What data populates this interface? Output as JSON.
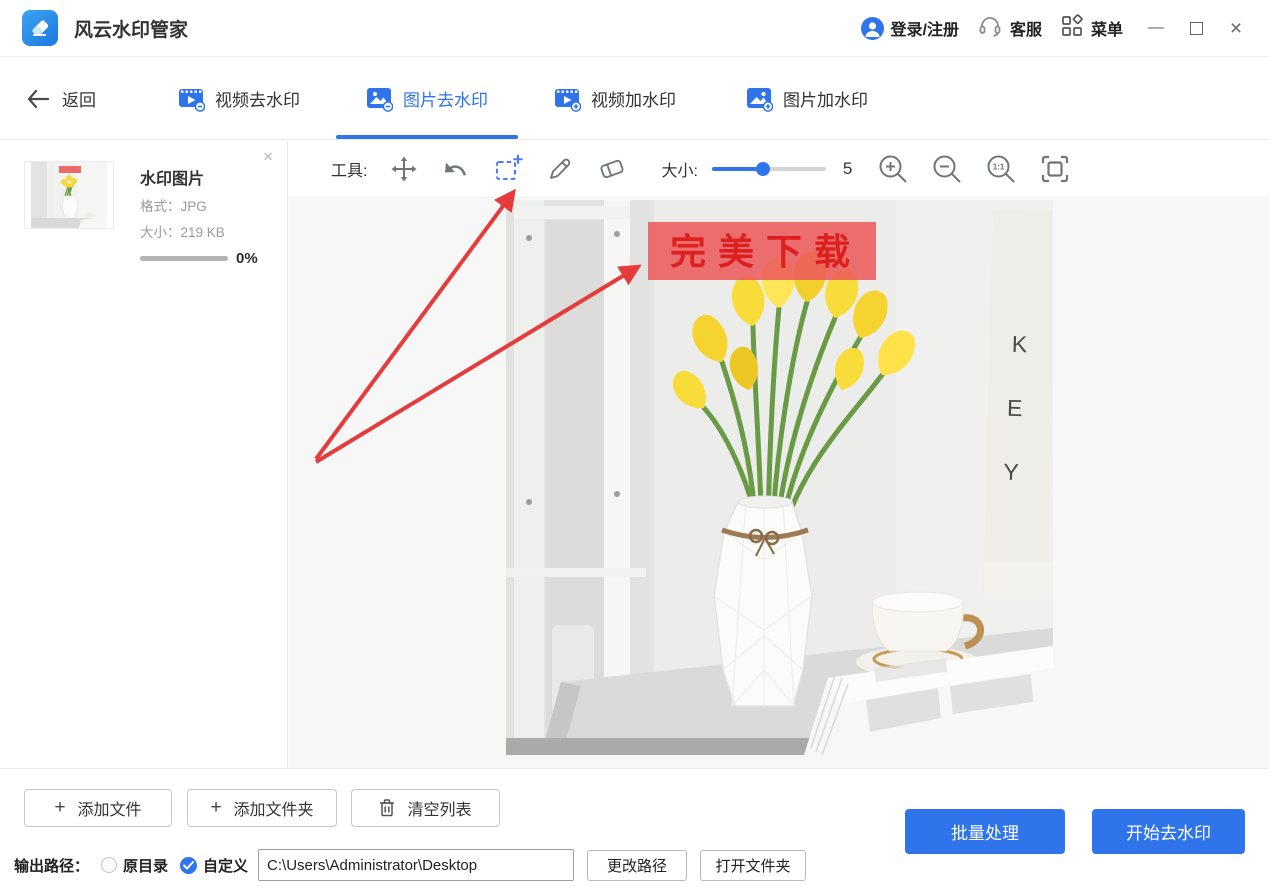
{
  "app": {
    "title": "风云水印管家"
  },
  "titlebar": {
    "login_label": "登录/注册",
    "service_label": "客服",
    "menu_label": "菜单",
    "minimize_glyph": "—",
    "close_glyph": "×"
  },
  "nav": {
    "back_label": "返回",
    "tabs": [
      {
        "label": "视频去水印"
      },
      {
        "label": "图片去水印"
      },
      {
        "label": "视频加水印"
      },
      {
        "label": "图片加水印"
      }
    ],
    "active_tab": "图片去水印"
  },
  "sidebar": {
    "file": {
      "name": "水印图片",
      "format_label": "格式：",
      "format_value": "JPG",
      "size_label": "大小：",
      "size_value": "219 KB",
      "progress_text": "0%",
      "remove_glyph": "×"
    }
  },
  "toolbar": {
    "tools_label": "工具:",
    "size_label": "大小:",
    "size_value": "5",
    "ratio_label": "1:1"
  },
  "canvas": {
    "watermark_text": "完美下载",
    "poster_letters": {
      "k": "K",
      "e": "E",
      "y": "Y"
    }
  },
  "footer": {
    "plus_glyph": "+",
    "add_file_label": "添加文件",
    "add_folder_label": "添加文件夹",
    "clear_list_label": "清空列表",
    "output_path_label": "输出路径：",
    "original_dir_label": "原目录",
    "custom_label": "自定义",
    "path_value": "C:\\Users\\Administrator\\Desktop",
    "change_path_label": "更改路径",
    "open_folder_label": "打开文件夹",
    "batch_label": "批量处理",
    "start_label": "开始去水印"
  },
  "colors": {
    "accent": "#2F74EB",
    "watermark_box": "#EC5B5B",
    "watermark_text": "#DC1F1F",
    "arrow_red": "#E63B3B"
  }
}
